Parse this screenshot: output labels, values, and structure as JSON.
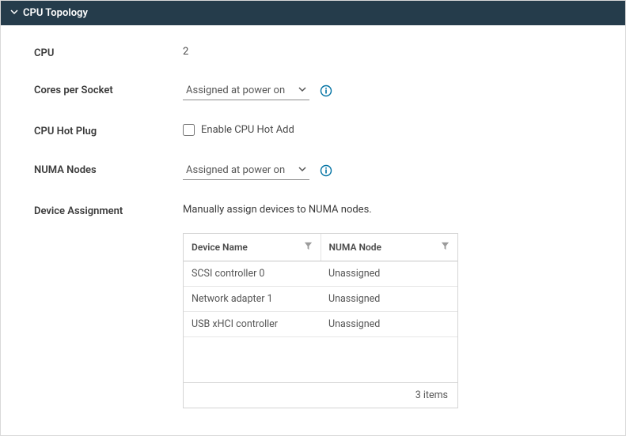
{
  "section": {
    "title": "CPU Topology"
  },
  "rows": {
    "cpu": {
      "label": "CPU",
      "value": "2"
    },
    "cores": {
      "label": "Cores per Socket",
      "select": "Assigned at power on"
    },
    "hotplug": {
      "label": "CPU Hot Plug",
      "checkbox_label": "Enable CPU Hot Add"
    },
    "numa": {
      "label": "NUMA Nodes",
      "select": "Assigned at power on"
    },
    "device": {
      "label": "Device Assignment",
      "desc": "Manually assign devices to NUMA nodes.",
      "columns": {
        "c0": "Device Name",
        "c1": "NUMA Node"
      },
      "r0": {
        "name": "SCSI controller 0",
        "node": "Unassigned"
      },
      "r1": {
        "name": "Network adapter 1",
        "node": "Unassigned"
      },
      "r2": {
        "name": "USB xHCI controller",
        "node": "Unassigned"
      },
      "footer": "3 items"
    }
  }
}
